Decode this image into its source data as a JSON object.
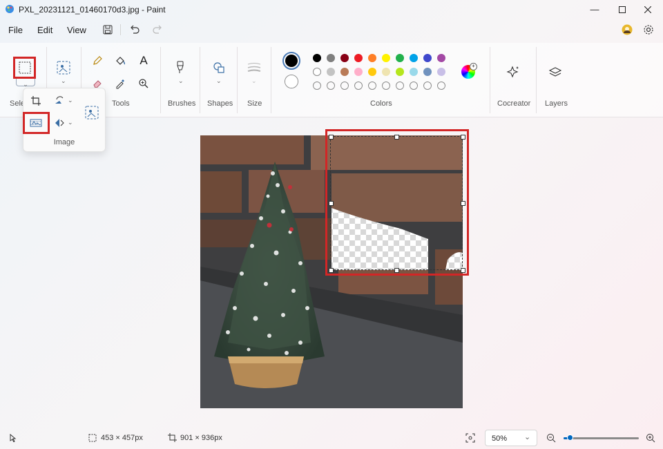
{
  "window": {
    "title": "PXL_20231121_01460170d3.jpg - Paint",
    "minimize_icon": "minimize-icon",
    "maximize_icon": "maximize-icon",
    "close_icon": "close-icon"
  },
  "menu": {
    "items": [
      {
        "label": "File"
      },
      {
        "label": "Edit"
      },
      {
        "label": "View"
      }
    ]
  },
  "ribbon": {
    "selection_label": "Sele",
    "tools_label": "Tools",
    "brushes_label": "Brushes",
    "shapes_label": "Shapes",
    "size_label": "Size",
    "colors_label": "Colors",
    "cocreator_label": "Cocreator",
    "layers_label": "Layers",
    "primary_color": "#000000",
    "secondary_color": "#ffffff",
    "palette_row1": [
      "#000000",
      "#7f7f7f",
      "#880015",
      "#ed1c24",
      "#ff7f27",
      "#fff200",
      "#22b14c",
      "#00a2e8",
      "#3f48cc",
      "#a349a4"
    ],
    "palette_row2": [
      "#ffffff",
      "#c3c3c3",
      "#b97a57",
      "#ffaec9",
      "#ffc90e",
      "#efe4b0",
      "#b5e61d",
      "#99d9ea",
      "#7092be",
      "#c8bfe7"
    ]
  },
  "image_flyout": {
    "label": "Image"
  },
  "status": {
    "selection_size": "453 × 457px",
    "canvas_size": "901 × 936px",
    "zoom": "50%",
    "zoom_level": 0.08
  },
  "highlight_color": "#d22626"
}
